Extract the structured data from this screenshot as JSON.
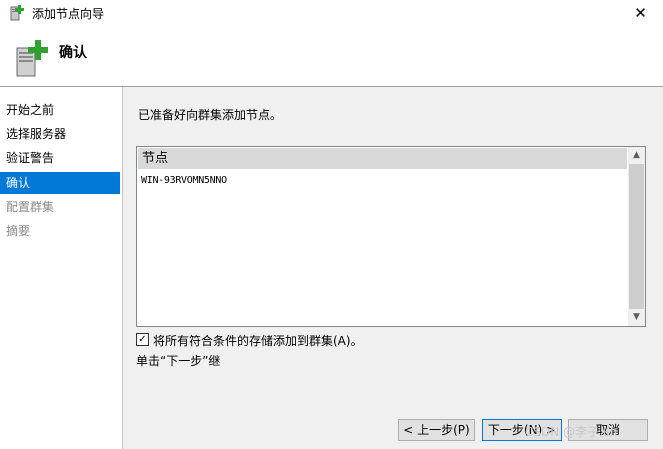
{
  "window": {
    "title": "添加节点向导",
    "close_symbol": "✕"
  },
  "header": {
    "title": "确认"
  },
  "sidebar": {
    "items": [
      {
        "label": "开始之前",
        "state": "normal"
      },
      {
        "label": "选择服务器",
        "state": "normal"
      },
      {
        "label": "验证警告",
        "state": "normal"
      },
      {
        "label": "确认",
        "state": "active"
      },
      {
        "label": "配置群集",
        "state": "disabled"
      },
      {
        "label": "摘要",
        "state": "disabled"
      }
    ]
  },
  "main": {
    "prompt": "已准备好向群集添加节点。",
    "list": {
      "header": "节点",
      "rows": [
        "WIN-93RVOMN5NNO"
      ]
    },
    "checkbox": {
      "label": "将所有符合条件的存储添加到群集(A)。",
      "checked": true
    },
    "hint": "单击“下一步”继"
  },
  "buttons": {
    "prev": "< 上一步(P)",
    "next": "下一步(N) >",
    "cancel": "取消"
  },
  "watermark": "CSDN @李子 lin",
  "colors": {
    "accent": "#0078d7",
    "panel": "#f0f0f0",
    "disabled_text": "#8b8b8b"
  },
  "icons": {
    "title": "server-add-icon",
    "header": "server-add-icon"
  }
}
